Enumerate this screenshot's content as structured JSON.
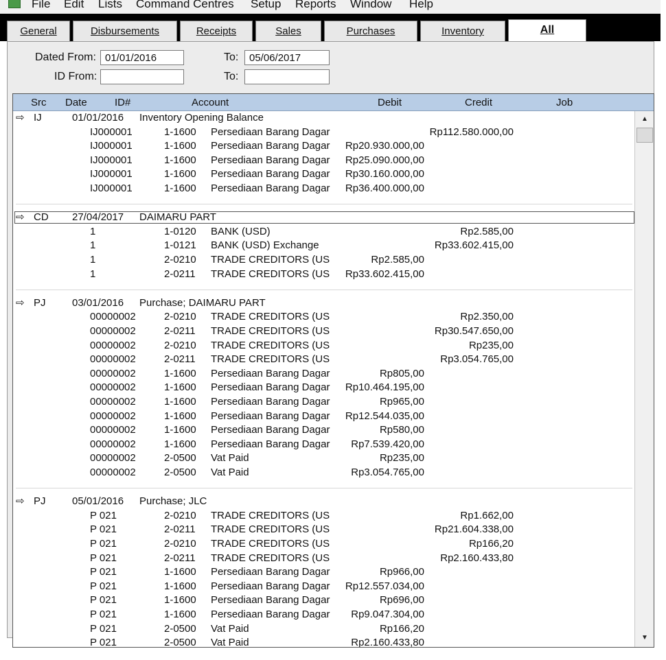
{
  "menu": {
    "items": [
      "File",
      "Edit",
      "Lists",
      "Command Centres",
      "Setup",
      "Reports",
      "Window",
      "Help"
    ]
  },
  "tabs": [
    {
      "label": "General",
      "active": false
    },
    {
      "label": "Disbursements",
      "active": false
    },
    {
      "label": "Receipts",
      "active": false
    },
    {
      "label": "Sales",
      "active": false
    },
    {
      "label": "Purchases",
      "active": false
    },
    {
      "label": "Inventory",
      "active": false
    },
    {
      "label": "All",
      "active": true
    }
  ],
  "filters": {
    "dated_from_label": "Dated From:",
    "dated_from_value": "01/01/2016",
    "dated_to_label": "To:",
    "dated_to_value": "05/06/2017",
    "id_from_label": "ID From:",
    "id_from_value": "",
    "id_to_label": "To:",
    "id_to_value": ""
  },
  "columns": {
    "src": "Src",
    "date": "Date",
    "id": "ID#",
    "account": "Account",
    "debit": "Debit",
    "credit": "Credit",
    "job": "Job"
  },
  "journal_groups": [
    {
      "src": "IJ",
      "date": "01/01/2016",
      "memo": "Inventory Opening Balance",
      "highlighted": false,
      "lines": [
        {
          "id": "IJ000001",
          "acct_no": "1-1600",
          "acct_name": "Persediaan Barang Dagar",
          "debit": "",
          "credit": "Rp112.580.000,00"
        },
        {
          "id": "IJ000001",
          "acct_no": "1-1600",
          "acct_name": "Persediaan Barang Dagar",
          "debit": "Rp20.930.000,00",
          "credit": ""
        },
        {
          "id": "IJ000001",
          "acct_no": "1-1600",
          "acct_name": "Persediaan Barang Dagar",
          "debit": "Rp25.090.000,00",
          "credit": ""
        },
        {
          "id": "IJ000001",
          "acct_no": "1-1600",
          "acct_name": "Persediaan Barang Dagar",
          "debit": "Rp30.160.000,00",
          "credit": ""
        },
        {
          "id": "IJ000001",
          "acct_no": "1-1600",
          "acct_name": "Persediaan Barang Dagar",
          "debit": "Rp36.400.000,00",
          "credit": ""
        }
      ]
    },
    {
      "src": "CD",
      "date": "27/04/2017",
      "memo": "DAIMARU PART",
      "highlighted": true,
      "lines": [
        {
          "id": "1",
          "acct_no": "1-0120",
          "acct_name": "BANK (USD)",
          "debit": "",
          "credit": "Rp2.585,00"
        },
        {
          "id": "1",
          "acct_no": "1-0121",
          "acct_name": "BANK (USD) Exchange",
          "debit": "",
          "credit": "Rp33.602.415,00"
        },
        {
          "id": "1",
          "acct_no": "2-0210",
          "acct_name": "TRADE CREDITORS (US",
          "debit": "Rp2.585,00",
          "credit": ""
        },
        {
          "id": "1",
          "acct_no": "2-0211",
          "acct_name": "TRADE CREDITORS (US",
          "debit": "Rp33.602.415,00",
          "credit": ""
        }
      ]
    },
    {
      "src": "PJ",
      "date": "03/01/2016",
      "memo": "Purchase; DAIMARU PART",
      "highlighted": false,
      "lines": [
        {
          "id": "00000002",
          "acct_no": "2-0210",
          "acct_name": "TRADE CREDITORS (US",
          "debit": "",
          "credit": "Rp2.350,00"
        },
        {
          "id": "00000002",
          "acct_no": "2-0211",
          "acct_name": "TRADE CREDITORS (US",
          "debit": "",
          "credit": "Rp30.547.650,00"
        },
        {
          "id": "00000002",
          "acct_no": "2-0210",
          "acct_name": "TRADE CREDITORS (US",
          "debit": "",
          "credit": "Rp235,00"
        },
        {
          "id": "00000002",
          "acct_no": "2-0211",
          "acct_name": "TRADE CREDITORS (US",
          "debit": "",
          "credit": "Rp3.054.765,00"
        },
        {
          "id": "00000002",
          "acct_no": "1-1600",
          "acct_name": "Persediaan Barang Dagar",
          "debit": "Rp805,00",
          "credit": ""
        },
        {
          "id": "00000002",
          "acct_no": "1-1600",
          "acct_name": "Persediaan Barang Dagar",
          "debit": "Rp10.464.195,00",
          "credit": ""
        },
        {
          "id": "00000002",
          "acct_no": "1-1600",
          "acct_name": "Persediaan Barang Dagar",
          "debit": "Rp965,00",
          "credit": ""
        },
        {
          "id": "00000002",
          "acct_no": "1-1600",
          "acct_name": "Persediaan Barang Dagar",
          "debit": "Rp12.544.035,00",
          "credit": ""
        },
        {
          "id": "00000002",
          "acct_no": "1-1600",
          "acct_name": "Persediaan Barang Dagar",
          "debit": "Rp580,00",
          "credit": ""
        },
        {
          "id": "00000002",
          "acct_no": "1-1600",
          "acct_name": "Persediaan Barang Dagar",
          "debit": "Rp7.539.420,00",
          "credit": ""
        },
        {
          "id": "00000002",
          "acct_no": "2-0500",
          "acct_name": "Vat Paid",
          "debit": "Rp235,00",
          "credit": ""
        },
        {
          "id": "00000002",
          "acct_no": "2-0500",
          "acct_name": "Vat Paid",
          "debit": "Rp3.054.765,00",
          "credit": ""
        }
      ]
    },
    {
      "src": "PJ",
      "date": "05/01/2016",
      "memo": "Purchase; JLC",
      "highlighted": false,
      "lines": [
        {
          "id": "P 021",
          "acct_no": "2-0210",
          "acct_name": "TRADE CREDITORS (US",
          "debit": "",
          "credit": "Rp1.662,00"
        },
        {
          "id": "P 021",
          "acct_no": "2-0211",
          "acct_name": "TRADE CREDITORS (US",
          "debit": "",
          "credit": "Rp21.604.338,00"
        },
        {
          "id": "P 021",
          "acct_no": "2-0210",
          "acct_name": "TRADE CREDITORS (US",
          "debit": "",
          "credit": "Rp166,20"
        },
        {
          "id": "P 021",
          "acct_no": "2-0211",
          "acct_name": "TRADE CREDITORS (US",
          "debit": "",
          "credit": "Rp2.160.433,80"
        },
        {
          "id": "P 021",
          "acct_no": "1-1600",
          "acct_name": "Persediaan Barang Dagar",
          "debit": "Rp966,00",
          "credit": ""
        },
        {
          "id": "P 021",
          "acct_no": "1-1600",
          "acct_name": "Persediaan Barang Dagar",
          "debit": "Rp12.557.034,00",
          "credit": ""
        },
        {
          "id": "P 021",
          "acct_no": "1-1600",
          "acct_name": "Persediaan Barang Dagar",
          "debit": "Rp696,00",
          "credit": ""
        },
        {
          "id": "P 021",
          "acct_no": "1-1600",
          "acct_name": "Persediaan Barang Dagar",
          "debit": "Rp9.047.304,00",
          "credit": ""
        },
        {
          "id": "P 021",
          "acct_no": "2-0500",
          "acct_name": "Vat Paid",
          "debit": "Rp166,20",
          "credit": ""
        },
        {
          "id": "P 021",
          "acct_no": "2-0500",
          "acct_name": "Vat Paid",
          "debit": "Rp2.160.433,80",
          "credit": ""
        }
      ]
    }
  ]
}
